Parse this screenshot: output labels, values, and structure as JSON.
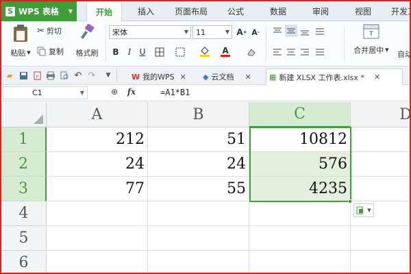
{
  "app": {
    "menu_label": "WPS 表格",
    "logo_letter": "S",
    "accent_color": "#3f9e3a"
  },
  "ribbon_tabs": [
    "开始",
    "插入",
    "页面布局",
    "公式",
    "数据",
    "审阅",
    "视图",
    "开发工"
  ],
  "active_tab": "开始",
  "clipboard": {
    "paste_label": "粘贴",
    "cut_label": "剪切",
    "copy_label": "复制",
    "format_painter_label": "格式刷"
  },
  "font": {
    "name": "宋体",
    "size": "11"
  },
  "alignment": {
    "merge_center_label": "合并居中",
    "wrap_label": "自动"
  },
  "doc_tabs": [
    {
      "label": "我的WPS",
      "icon": "wps-logo-icon"
    },
    {
      "label": "云文档",
      "icon": "cloud-cube-icon"
    },
    {
      "label": "新建 XLSX 工作表.xlsx *",
      "icon": "sheet-doc-icon"
    }
  ],
  "formula_bar": {
    "cell_ref": "C1",
    "fx_label": "fx",
    "formula": "=A1*B1"
  },
  "sheet": {
    "columns": [
      "A",
      "B",
      "C",
      "D"
    ],
    "rows": [
      "1",
      "2",
      "3",
      "4",
      "5",
      "6"
    ],
    "selected_column": "C",
    "cells": [
      [
        "212",
        "51",
        "10812",
        ""
      ],
      [
        "24",
        "24",
        "576",
        ""
      ],
      [
        "77",
        "55",
        "4235",
        ""
      ]
    ]
  }
}
